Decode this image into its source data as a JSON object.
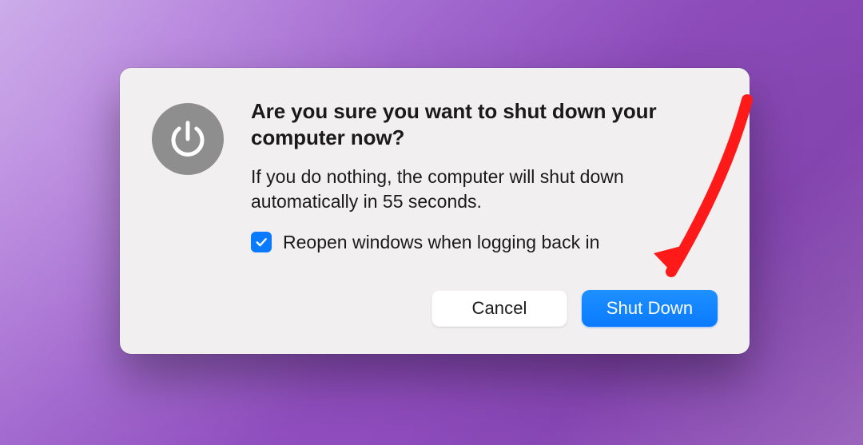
{
  "dialog": {
    "title": "Are you sure you want to shut down your computer now?",
    "message": "If you do nothing, the computer will shut down automatically in 55 seconds.",
    "checkbox": {
      "label": "Reopen windows when logging back in",
      "checked": true
    },
    "buttons": {
      "cancel": "Cancel",
      "confirm": "Shut Down"
    },
    "icon": "power-icon",
    "colors": {
      "primary": "#0a7aff",
      "annotation": "#ff1a1a",
      "iconBg": "#8e8e8e",
      "dialogBg": "#f2eff0"
    }
  }
}
